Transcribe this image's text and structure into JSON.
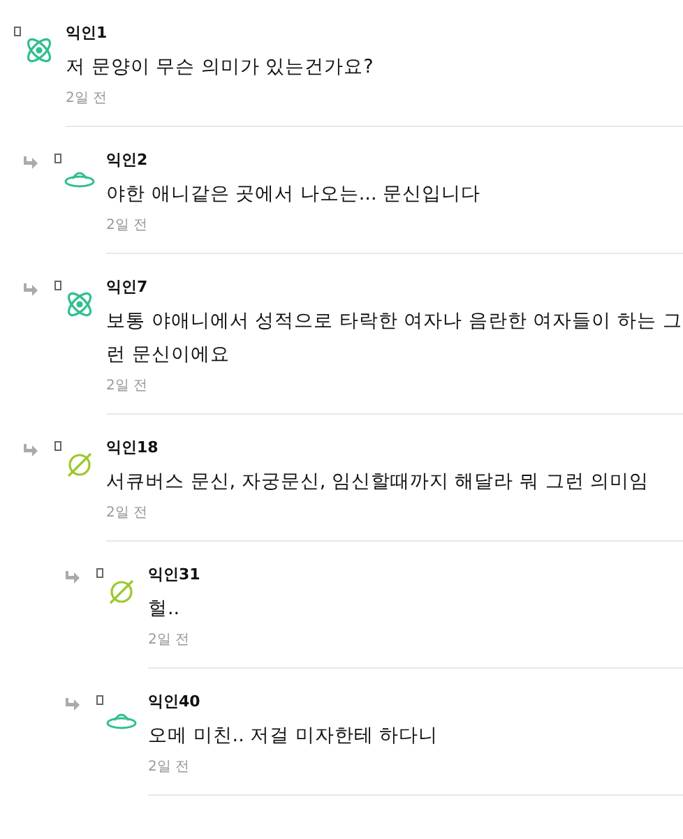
{
  "comments": [
    {
      "author": "익인1",
      "kind": "atom",
      "body": "저 문양이 무슨 의미가 있는건가요?",
      "time": "2일 전",
      "children": [
        {
          "author": "익인2",
          "kind": "ufo",
          "body": "야한 애니같은 곳에서 나오는... 문신입니다",
          "time": "2일 전"
        },
        {
          "author": "익인7",
          "kind": "atom",
          "body": "보통 야애니에서 성적으로 타락한 여자나 음란한 여자들이 하는 그런 문신이에요",
          "time": "2일 전"
        },
        {
          "author": "익인18",
          "kind": "planet",
          "body": "서큐버스 문신, 자궁문신, 임신할때까지 해달라 뭐 그런 의미임",
          "time": "2일 전",
          "children": [
            {
              "author": "익인31",
              "kind": "planet",
              "body": "헐..",
              "time": "2일 전"
            },
            {
              "author": "익인40",
              "kind": "ufo",
              "body": "오메 미친.. 저걸 미자한테 하다니",
              "time": "2일 전"
            }
          ]
        }
      ]
    }
  ]
}
